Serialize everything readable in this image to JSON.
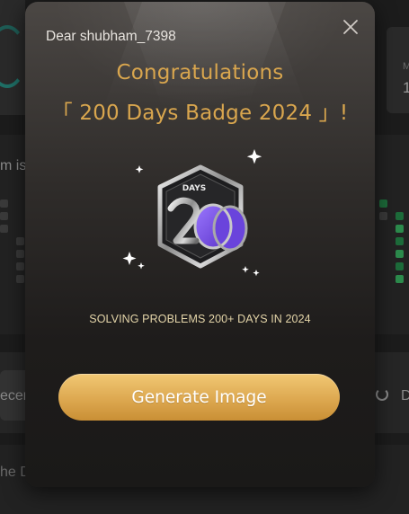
{
  "background": {
    "left_labels": [
      "m is",
      "ecen",
      "he D"
    ],
    "right_labels": [
      "M",
      "1",
      "D"
    ]
  },
  "modal": {
    "greeting": "Dear shubham_7398",
    "title_line1": "Congratulations",
    "title_line2": "「 200 Days Badge 2024 」!",
    "badge": {
      "label": "DAYS",
      "number": "200"
    },
    "subtitle": "SOLVING PROBLEMS 200+ DAYS IN 2024",
    "generate_button_label": "Generate Image",
    "close_icon": "close-icon"
  },
  "colors": {
    "title": "#d9a64e",
    "button_gradient_top": "#f1c874",
    "button_gradient_bottom": "#c98f35",
    "badge_purple": "#7a52e6"
  }
}
